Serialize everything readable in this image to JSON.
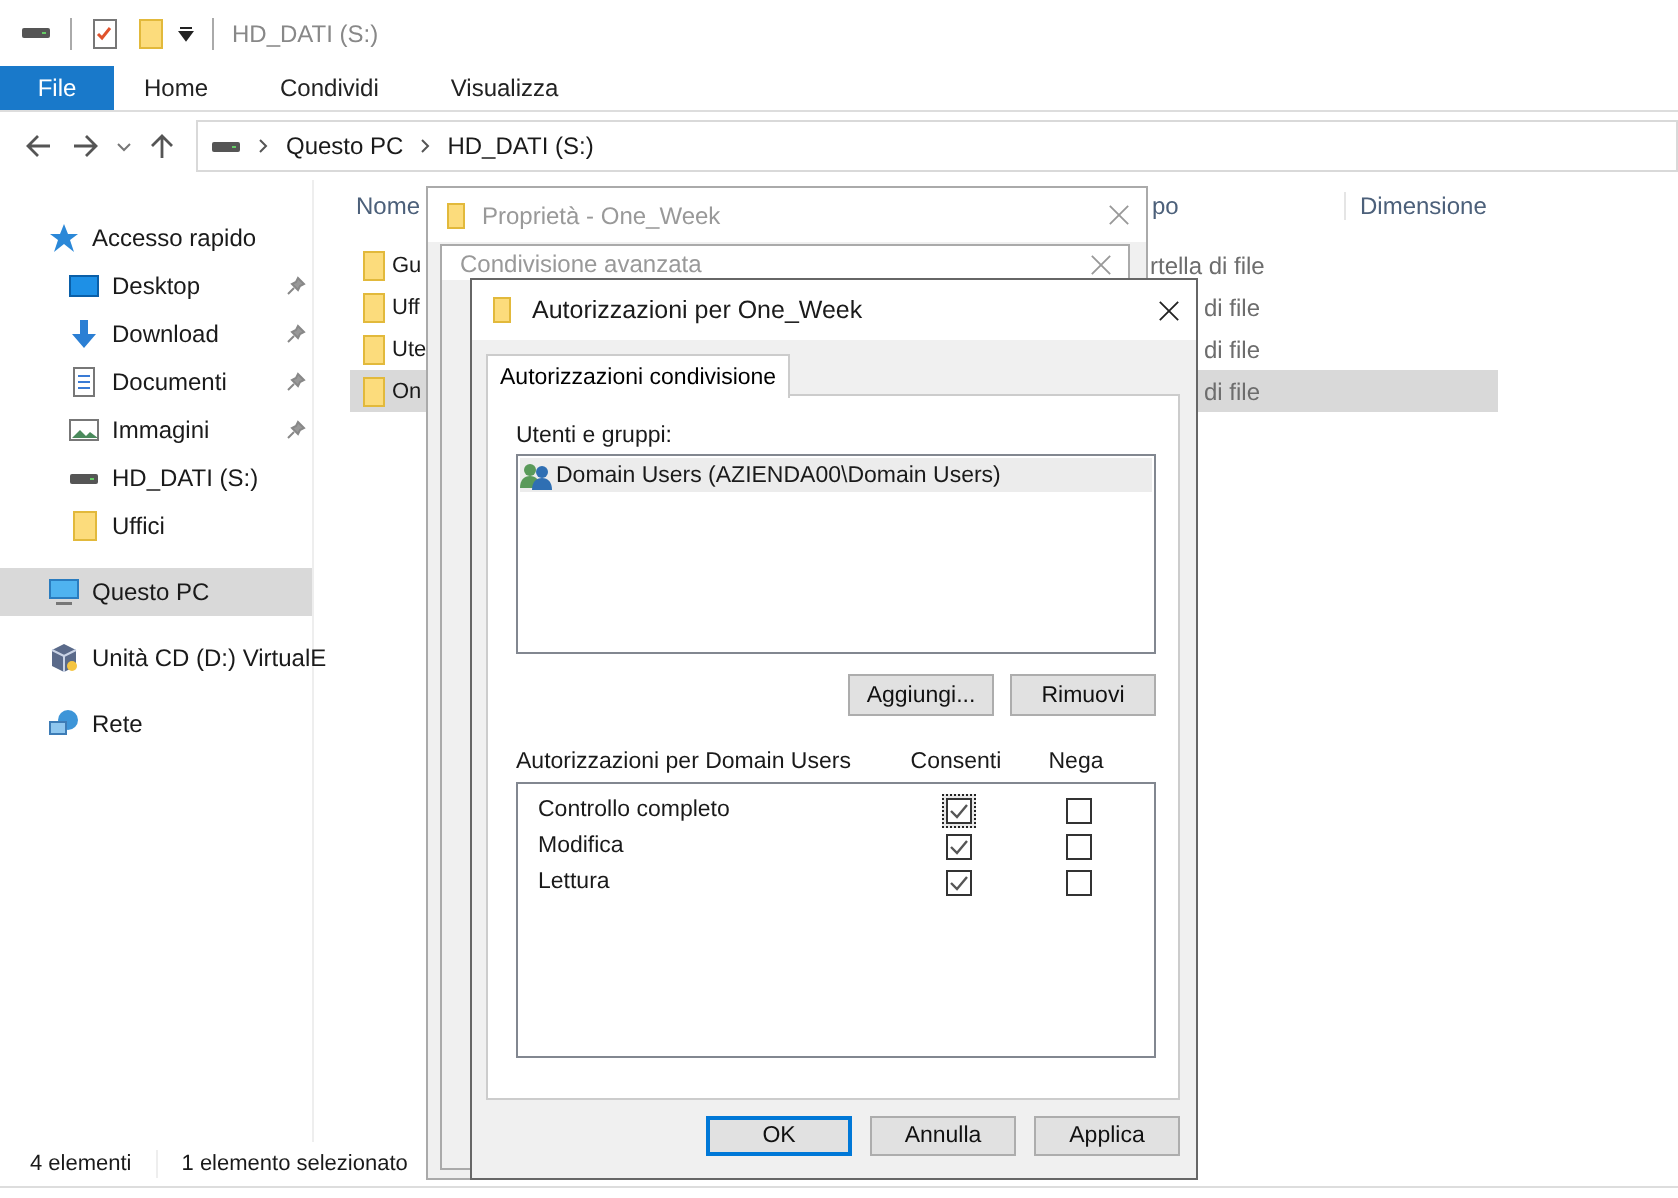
{
  "title_bar": {
    "title": "HD_DATI (S:)"
  },
  "ribbon": {
    "file_button": "File",
    "tabs": [
      "Home",
      "Condividi",
      "Visualizza"
    ]
  },
  "address_bar": {
    "path": [
      "Questo PC",
      "HD_DATI (S:)"
    ]
  },
  "sidebar": {
    "items": [
      {
        "label": "Accesso rapido",
        "kind": "star",
        "selected": false,
        "children": [
          {
            "label": "Desktop",
            "kind": "desktop",
            "pinned": true,
            "selected": false
          },
          {
            "label": "Download",
            "kind": "download",
            "pinned": true,
            "selected": false
          },
          {
            "label": "Documenti",
            "kind": "document",
            "pinned": true,
            "selected": false
          },
          {
            "label": "Immagini",
            "kind": "image",
            "pinned": true,
            "selected": false
          },
          {
            "label": "HD_DATI (S:)",
            "kind": "drive",
            "pinned": false,
            "selected": false
          },
          {
            "label": "Uffici",
            "kind": "folder",
            "pinned": false,
            "selected": false
          }
        ]
      },
      {
        "label": "Questo PC",
        "kind": "computer",
        "selected": true
      },
      {
        "label": "Unità CD (D:) VirtualE",
        "kind": "cd",
        "selected": false
      },
      {
        "label": "Rete",
        "kind": "network",
        "selected": false
      }
    ]
  },
  "file_list": {
    "columns": [
      "Nome",
      "po",
      "Dimensione"
    ],
    "rows": [
      {
        "name": "Gu",
        "type": "rtella di file",
        "selected": false
      },
      {
        "name": "Uff",
        "type": "di file",
        "selected": false
      },
      {
        "name": "Ute",
        "type": "di file",
        "selected": false
      },
      {
        "name": "On",
        "type": "di file",
        "selected": true
      }
    ]
  },
  "status_bar": {
    "count": "4 elementi",
    "selection": "1 elemento selezionato"
  },
  "properties_dialog": {
    "title": "Proprietà - One_Week"
  },
  "advanced_sharing_dialog": {
    "title": "Condivisione avanzata"
  },
  "permissions_dialog": {
    "title": "Autorizzazioni per One_Week",
    "tabs": [
      {
        "label": "Autorizzazioni condivisione",
        "selected": true
      }
    ],
    "users_label": "Utenti e gruppi:",
    "users": [
      {
        "name": "Domain Users (AZIENDA00\\Domain Users)",
        "selected": true
      }
    ],
    "user_buttons": [
      "Aggiungi...",
      "Rimuovi"
    ],
    "permissions_label": "Autorizzazioni per Domain Users",
    "columns": [
      "Consenti",
      "Nega"
    ],
    "permissions": [
      {
        "name": "Controllo completo",
        "allow": true,
        "deny": false,
        "focused": true
      },
      {
        "name": "Modifica",
        "allow": true,
        "deny": false,
        "focused": false
      },
      {
        "name": "Lettura",
        "allow": true,
        "deny": false,
        "focused": false
      }
    ],
    "footer_buttons": [
      {
        "label": "OK",
        "default": true
      },
      {
        "label": "Annulla",
        "default": false
      },
      {
        "label": "Applica",
        "default": false
      }
    ]
  }
}
